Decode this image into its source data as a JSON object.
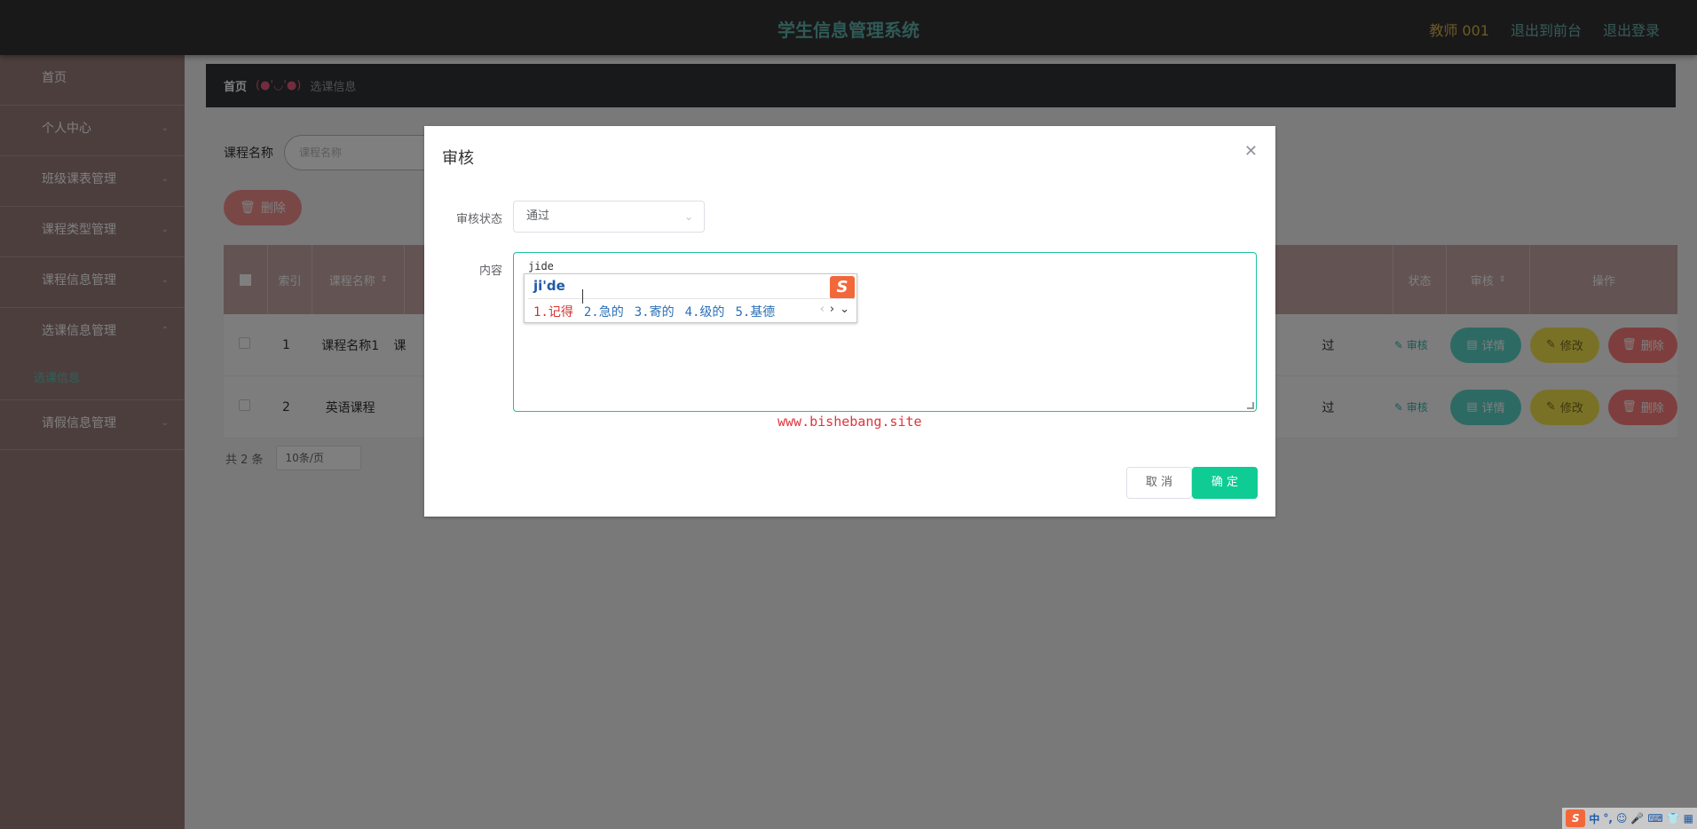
{
  "header": {
    "title": "学生信息管理系统",
    "teacher": "教师 001",
    "back_front": "退出到前台",
    "logout": "退出登录"
  },
  "sidebar": {
    "items": [
      {
        "label": "首页"
      },
      {
        "label": "个人中心"
      },
      {
        "label": "班级课表管理"
      },
      {
        "label": "课程类型管理"
      },
      {
        "label": "课程信息管理"
      },
      {
        "label": "选课信息管理"
      }
    ],
    "sub_item": "选课信息",
    "last_item": "请假信息管理"
  },
  "breadcrumb": {
    "home": "首页",
    "face": "(●'◡'●)",
    "current": "选课信息"
  },
  "search": {
    "label": "课程名称",
    "placeholder": "课程名称"
  },
  "toolbar": {
    "delete_label": "删除"
  },
  "table": {
    "headers": {
      "index": "索引",
      "course_name": "课程名称",
      "status": "状态",
      "audit": "审核",
      "actions": "操作"
    },
    "rows": [
      {
        "index": "1",
        "course_name": "课程名称1",
        "course_col2": "课",
        "status": "过",
        "audit": "审核"
      },
      {
        "index": "2",
        "course_name": "英语课程",
        "course_col2": "",
        "status": "过",
        "audit": "审核"
      }
    ],
    "btn_detail": "详情",
    "btn_edit": "修改",
    "btn_delete": "删除"
  },
  "pagination": {
    "total": "共 2 条",
    "page_size": "10条/页"
  },
  "dialog": {
    "title": "审核",
    "status_label": "审核状态",
    "status_value": "通过",
    "content_label": "内容",
    "content_typed": "jide",
    "watermark": "www.bishebang.site",
    "cancel": "取 消",
    "ok": "确 定"
  },
  "ime": {
    "composition": "ji'de",
    "logo": "S",
    "candidates": [
      "1.记得",
      "2.急的",
      "3.寄的",
      "4.级的",
      "5.基德"
    ]
  },
  "tray": {
    "logo": "S",
    "mode": "中"
  },
  "colors": {
    "header_bg": "#333333",
    "title": "#5fb4ad",
    "sidebar_bg": "#9b7c7c",
    "accent_green": "#0fcc94",
    "danger": "#ff7d7d"
  }
}
